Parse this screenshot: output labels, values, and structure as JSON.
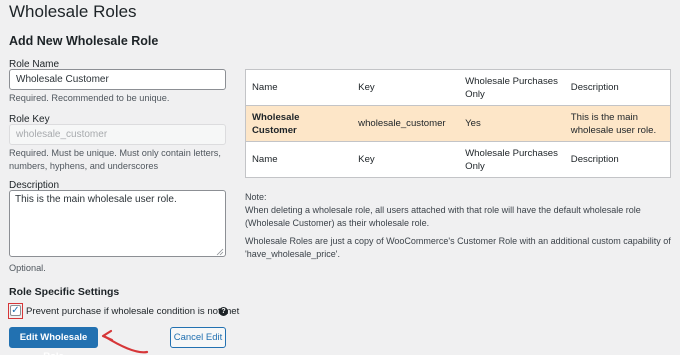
{
  "page": {
    "title": "Wholesale Roles"
  },
  "form": {
    "section_title": "Add New Wholesale Role",
    "role_name": {
      "label": "Role Name",
      "value": "Wholesale Customer",
      "help": "Required. Recommended to be unique."
    },
    "role_key": {
      "label": "Role Key",
      "value": "wholesale_customer",
      "help_line1": "Required. Must be unique. Must only contain letters,",
      "help_line2": "numbers, hyphens, and underscores"
    },
    "description": {
      "label": "Description",
      "value": "This is the main wholesale user role.",
      "help": "Optional."
    },
    "settings_title": "Role Specific Settings",
    "prevent_purchase": {
      "label": "Prevent purchase if wholesale condition is not met",
      "checked": true,
      "check_glyph": "✓",
      "help_glyph": "?"
    },
    "primary_button": "Edit Wholesale Role",
    "cancel_button": "Cancel Edit"
  },
  "table": {
    "headers": [
      "Name",
      "Key",
      "Wholesale Purchases Only",
      "Description"
    ],
    "rows": [
      {
        "name": "Wholesale Customer",
        "key": "wholesale_customer",
        "purchases_only": "Yes",
        "description": "This is the main wholesale user role.",
        "highlight": "#fde6c8"
      }
    ],
    "footers": [
      "Name",
      "Key",
      "Wholesale Purchases Only",
      "Description"
    ]
  },
  "note": {
    "heading": "Note:",
    "para1": "When deleting a wholesale role, all users attached with that role will have the default wholesale role (Wholesale Customer) as their wholesale role.",
    "para2": "Wholesale Roles are just a copy of WooCommerce's Customer Role with an additional custom capability of 'have_wholesale_price'."
  },
  "colors": {
    "accent": "#2271b1",
    "highlight_row": "#fde6c8",
    "annotation": "#d63638"
  }
}
